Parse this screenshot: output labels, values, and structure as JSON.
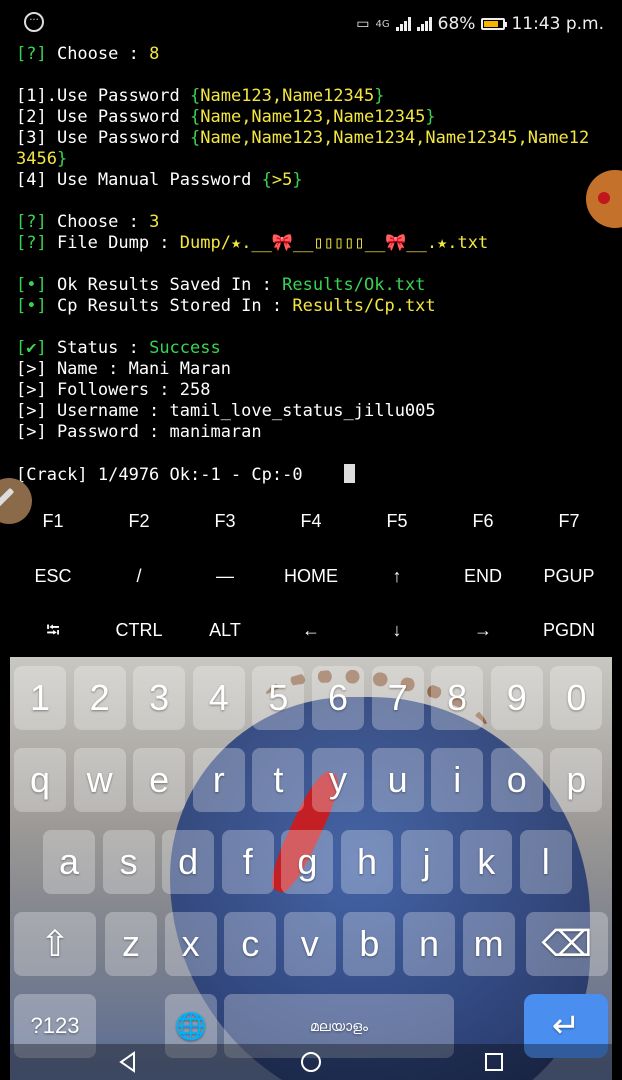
{
  "status_bar": {
    "network": "4G",
    "battery_percent": "68%",
    "time": "11:43 p.m."
  },
  "terminal": {
    "lines": [
      [
        {
          "t": "[?]",
          "c": "g"
        },
        {
          "t": " Choose : ",
          "c": "w"
        },
        {
          "t": "8",
          "c": "y"
        }
      ],
      [],
      [
        {
          "t": "[1].Use Password ",
          "c": "w"
        },
        {
          "t": "{",
          "c": "g"
        },
        {
          "t": "Name123,Name12345",
          "c": "y"
        },
        {
          "t": "}",
          "c": "g"
        }
      ],
      [
        {
          "t": "[2] Use Password ",
          "c": "w"
        },
        {
          "t": "{",
          "c": "g"
        },
        {
          "t": "Name,Name123,Name12345",
          "c": "y"
        },
        {
          "t": "}",
          "c": "g"
        }
      ],
      [
        {
          "t": "[3] Use Password ",
          "c": "w"
        },
        {
          "t": "{",
          "c": "g"
        },
        {
          "t": "Name,Name123,Name1234,Name12345,Name12",
          "c": "y"
        }
      ],
      [
        {
          "t": "3456",
          "c": "y"
        },
        {
          "t": "}",
          "c": "g"
        }
      ],
      [
        {
          "t": "[4] Use Manual Password ",
          "c": "w"
        },
        {
          "t": "{",
          "c": "g"
        },
        {
          "t": ">5",
          "c": "y"
        },
        {
          "t": "}",
          "c": "g"
        }
      ],
      [],
      [
        {
          "t": "[?]",
          "c": "g"
        },
        {
          "t": " Choose : ",
          "c": "w"
        },
        {
          "t": "3",
          "c": "y"
        }
      ],
      [
        {
          "t": "[?]",
          "c": "g"
        },
        {
          "t": " File Dump : ",
          "c": "w"
        },
        {
          "t": "Dump/★.__🎀__▯▯▯▯▯__🎀__.★.txt",
          "c": "y"
        }
      ],
      [],
      [
        {
          "t": "[•]",
          "c": "g"
        },
        {
          "t": " Ok Results Saved In : ",
          "c": "w"
        },
        {
          "t": "Results/Ok.txt",
          "c": "g"
        }
      ],
      [
        {
          "t": "[•]",
          "c": "g"
        },
        {
          "t": " Cp Results Stored In : ",
          "c": "w"
        },
        {
          "t": "Results/Cp.txt",
          "c": "y"
        }
      ],
      [],
      [
        {
          "t": "[✔]",
          "c": "g"
        },
        {
          "t": " Status : ",
          "c": "w"
        },
        {
          "t": "Success",
          "c": "g"
        }
      ],
      [
        {
          "t": "[>] Name : Mani Maran",
          "c": "w"
        }
      ],
      [
        {
          "t": "[>] Followers : 258",
          "c": "w"
        }
      ],
      [
        {
          "t": "[>] Username : tamil_love_status_jillu005",
          "c": "w"
        }
      ],
      [
        {
          "t": "[>] Password : manimaran",
          "c": "w"
        }
      ],
      [],
      [
        {
          "t": "[Crack] 1/4976 Ok:-1 - Cp:-0",
          "c": "w"
        }
      ]
    ]
  },
  "extra_keys": {
    "row1": [
      "F1",
      "F2",
      "F3",
      "F4",
      "F5",
      "F6",
      "F7"
    ],
    "row2": [
      "ESC",
      "/",
      "—",
      "HOME",
      "↑",
      "END",
      "PGUP"
    ],
    "row3": [
      "⭾",
      "CTRL",
      "ALT",
      "←",
      "↓",
      "→",
      "PGDN"
    ]
  },
  "keyboard": {
    "numbers": [
      "1",
      "2",
      "3",
      "4",
      "5",
      "6",
      "7",
      "8",
      "9",
      "0"
    ],
    "row1": [
      "q",
      "w",
      "e",
      "r",
      "t",
      "y",
      "u",
      "i",
      "o",
      "p"
    ],
    "row2": [
      "a",
      "s",
      "d",
      "f",
      "g",
      "h",
      "j",
      "k",
      "l"
    ],
    "row3": [
      "z",
      "x",
      "c",
      "v",
      "b",
      "n",
      "m"
    ],
    "symbols_label": "?123",
    "space_label": "മലയാളം",
    "shift_icon": "⇧",
    "backspace_icon": "⌫",
    "enter_icon": "↵",
    "globe_icon": "🌐"
  },
  "nav_icons": [
    "back-icon",
    "home-icon",
    "recents-icon"
  ]
}
